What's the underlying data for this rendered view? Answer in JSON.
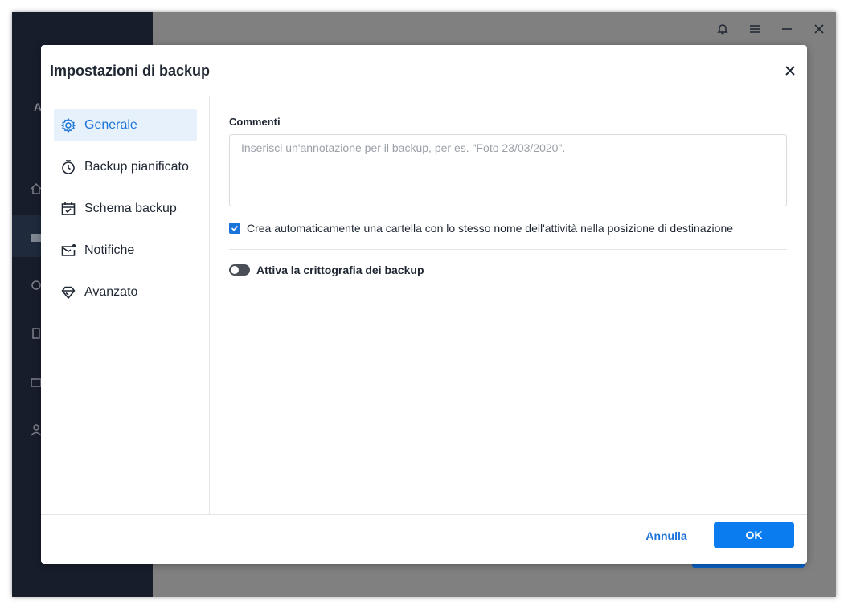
{
  "background_app": {
    "sidebar_letter": "A"
  },
  "dialog": {
    "title": "Impostazioni di backup",
    "close_icon": "close-icon"
  },
  "nav": {
    "items": [
      {
        "label": "Generale",
        "icon": "gear-icon",
        "active": true
      },
      {
        "label": "Backup pianificato",
        "icon": "stopwatch-icon",
        "active": false
      },
      {
        "label": "Schema backup",
        "icon": "calendar-check-icon",
        "active": false
      },
      {
        "label": "Notifiche",
        "icon": "mail-notification-icon",
        "active": false
      },
      {
        "label": "Avanzato",
        "icon": "diamond-icon",
        "active": false
      }
    ]
  },
  "content": {
    "comments_label": "Commenti",
    "comments_value": "",
    "comments_placeholder": "Inserisci un'annotazione per il backup, per es. \"Foto 23/03/2020\".",
    "auto_folder_label": "Crea automaticamente una cartella con lo stesso nome dell'attività nella posizione di destinazione",
    "auto_folder_checked": true,
    "encryption_label": "Attiva la crittografia dei backup",
    "encryption_enabled": false
  },
  "footer": {
    "cancel_label": "Annulla",
    "ok_label": "OK"
  },
  "colors": {
    "accent": "#1a73d9",
    "ok_button": "#0a7cf0",
    "active_nav_bg": "#e6f1fc",
    "app_sidebar": "#171d2b"
  }
}
